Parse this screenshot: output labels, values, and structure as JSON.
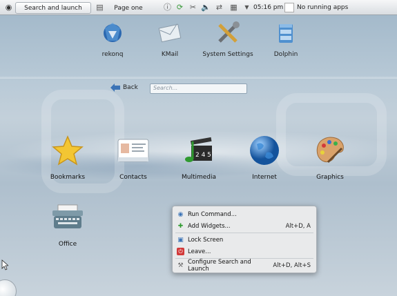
{
  "panel": {
    "search_launch_label": "Search and launch",
    "page_label": "Page one",
    "clock": "05:16 pm",
    "tasks_label": "No running apps"
  },
  "favorites": [
    {
      "label": "rekonq",
      "icon": "rekonq-browser-icon"
    },
    {
      "label": "KMail",
      "icon": "kmail-envelope-icon"
    },
    {
      "label": "System Settings",
      "icon": "system-settings-tools-icon"
    },
    {
      "label": "Dolphin",
      "icon": "dolphin-file-manager-icon"
    }
  ],
  "nav": {
    "back_label": "Back",
    "search_placeholder": "Search..."
  },
  "categories": [
    {
      "label": "Bookmarks",
      "icon": "bookmarks-star-icon"
    },
    {
      "label": "Contacts",
      "icon": "contacts-card-icon"
    },
    {
      "label": "Multimedia",
      "icon": "multimedia-clapper-icon"
    },
    {
      "label": "Internet",
      "icon": "internet-globe-icon"
    },
    {
      "label": "Graphics",
      "icon": "graphics-palette-icon"
    },
    {
      "label": "Office",
      "icon": "office-typewriter-icon"
    }
  ],
  "context_menu": {
    "items": [
      {
        "label": "Run Command...",
        "shortcut": "",
        "icon": "run-command-icon"
      },
      {
        "label": "Add Widgets...",
        "shortcut": "Alt+D, A",
        "icon": "add-widgets-icon"
      },
      {
        "label": "Lock Screen",
        "shortcut": "",
        "icon": "lock-screen-icon"
      },
      {
        "label": "Leave...",
        "shortcut": "",
        "icon": "leave-icon"
      },
      {
        "label": "Configure Search and Launch",
        "shortcut": "Alt+D, Alt+S",
        "icon": "configure-icon"
      }
    ]
  }
}
